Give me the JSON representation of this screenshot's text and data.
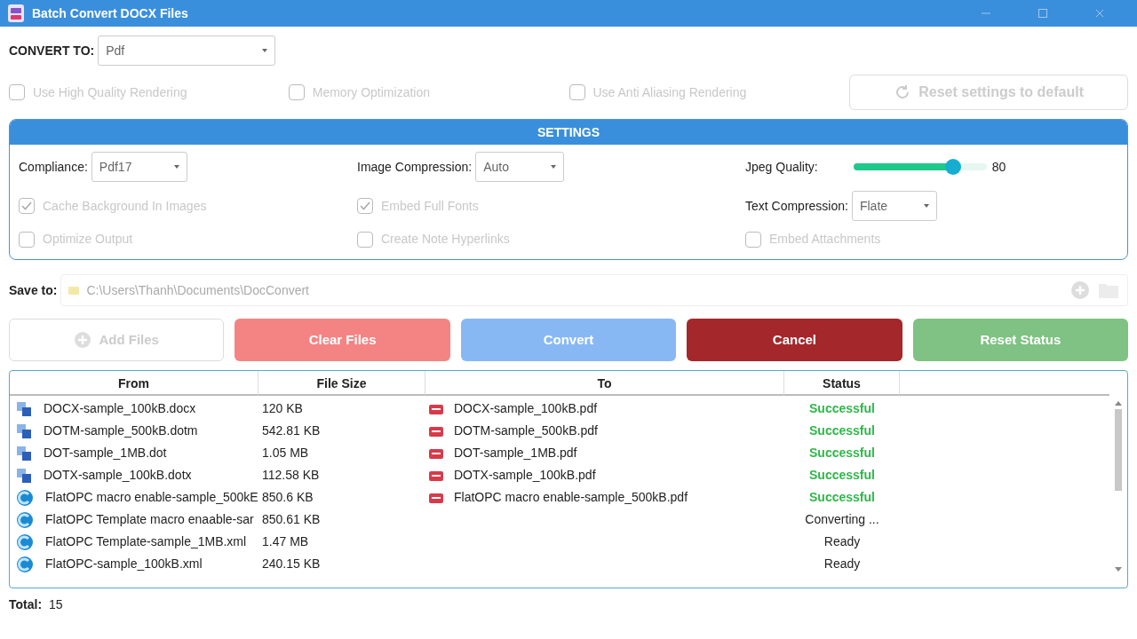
{
  "window": {
    "title": "Batch Convert DOCX Files"
  },
  "convert_to": {
    "label": "CONVERT TO:",
    "value": "Pdf"
  },
  "options": [
    {
      "label": "Use High Quality Rendering",
      "checked": false,
      "disabled": true
    },
    {
      "label": "Memory Optimization",
      "checked": false,
      "disabled": true
    },
    {
      "label": "Use Anti Aliasing Rendering",
      "checked": false,
      "disabled": true
    }
  ],
  "reset_settings_button": {
    "label": "Reset settings to default",
    "disabled": true
  },
  "settings": {
    "title": "SETTINGS",
    "compliance": {
      "label": "Compliance:",
      "value": "Pdf17"
    },
    "image_compression": {
      "label": "Image Compression:",
      "value": "Auto"
    },
    "jpeg_quality": {
      "label": "Jpeg Quality:",
      "level": 0.75,
      "reading": "80"
    },
    "text_compression": {
      "label": "Text Compression:",
      "value": "Flate"
    },
    "checkboxes": [
      {
        "label": "Cache Background In Images",
        "checked": true,
        "disabled": true
      },
      {
        "label": "Embed Full Fonts",
        "checked": true,
        "disabled": true
      },
      {
        "label": "Optimize Output",
        "checked": false,
        "disabled": true
      },
      {
        "label": "Create Note Hyperlinks",
        "checked": false,
        "disabled": true
      },
      {
        "label": "Embed Attachments",
        "checked": false,
        "disabled": true
      }
    ]
  },
  "save_to": {
    "label": "Save to:",
    "value": "C:\\Users\\Thanh\\Documents\\DocConvert"
  },
  "buttons": [
    {
      "label": "Add Files",
      "kind": "add",
      "color": "#ffffff",
      "disabled": true
    },
    {
      "label": "Clear Files",
      "kind": "plain",
      "color": "#f48484",
      "disabled": false
    },
    {
      "label": "Convert",
      "kind": "plain",
      "color": "#88b8f4",
      "disabled": false
    },
    {
      "label": "Cancel",
      "kind": "plain",
      "color": "#a4272b",
      "disabled": false
    },
    {
      "label": "Reset Status",
      "kind": "plain",
      "color": "#7fc283",
      "disabled": false
    }
  ],
  "table": {
    "columns": [
      "From",
      "File Size",
      "To",
      "Status"
    ],
    "rows": [
      {
        "from": "DOCX-sample_100kB.docx",
        "kind": "word",
        "size": "120 KB",
        "to": "DOCX-sample_100kB.pdf",
        "status": "Successful",
        "successful": true
      },
      {
        "from": "DOTM-sample_500kB.dotm",
        "kind": "word",
        "size": "542.81 KB",
        "to": "DOTM-sample_500kB.pdf",
        "status": "Successful",
        "successful": true
      },
      {
        "from": "DOT-sample_1MB.dot",
        "kind": "word",
        "size": "1.05 MB",
        "to": "DOT-sample_1MB.pdf",
        "status": "Successful",
        "successful": true
      },
      {
        "from": "DOTX-sample_100kB.dotx",
        "kind": "word",
        "size": "112.58 KB",
        "to": "DOTX-sample_100kB.pdf",
        "status": "Successful",
        "successful": true
      },
      {
        "from": "FlatOPC macro enable-sample_500kE",
        "kind": "xml",
        "size": "850.6 KB",
        "to": "FlatOPC macro enable-sample_500kB.pdf",
        "status": "Successful",
        "successful": true
      },
      {
        "from": "FlatOPC Template macro enaable-sar",
        "kind": "xml",
        "size": "850.61 KB",
        "status": "Converting ...",
        "successful": false
      },
      {
        "from": "FlatOPC Template-sample_1MB.xml",
        "kind": "xml",
        "size": "1.47 MB",
        "status": "Ready",
        "successful": false
      },
      {
        "from": "FlatOPC-sample_100kB.xml",
        "kind": "xml",
        "size": "240.15 KB",
        "status": "Ready",
        "successful": false
      }
    ]
  },
  "total": {
    "label": "Total:",
    "value": "15"
  }
}
